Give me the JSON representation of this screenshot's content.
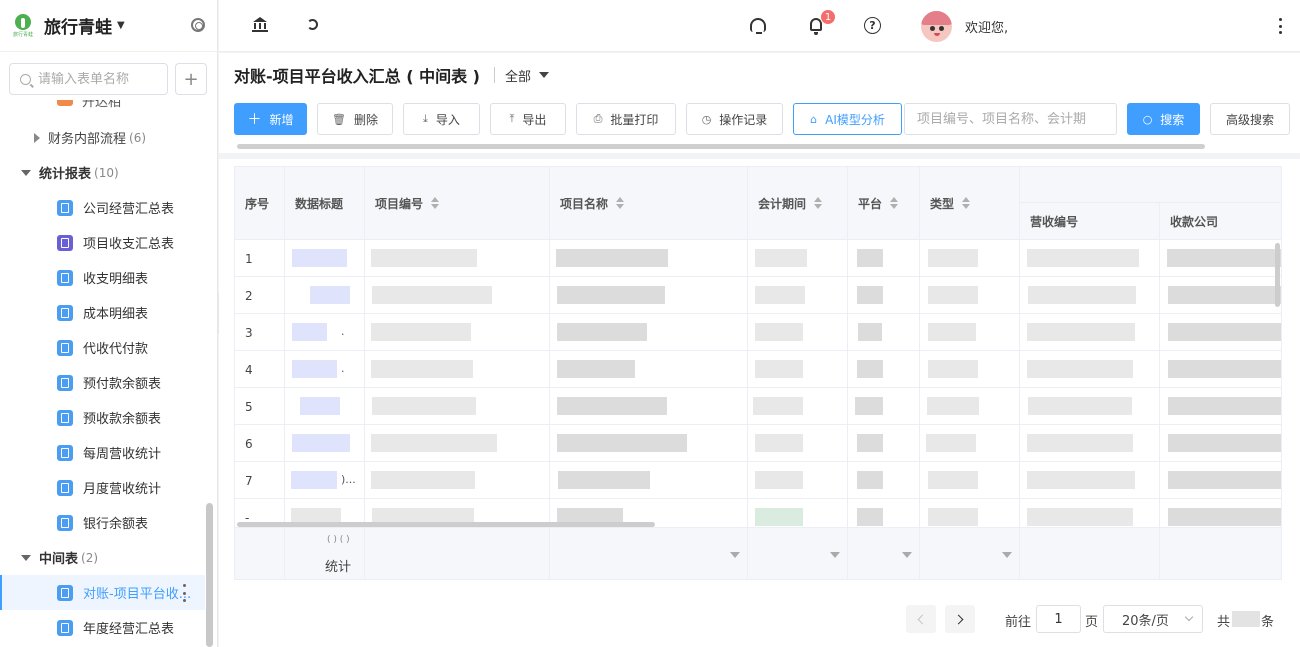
{
  "app": {
    "brand_name": "旅行青蛙",
    "logo_text": "旅行青蛙",
    "welcome_text": "欢迎您,",
    "notification_count": "1"
  },
  "sidebar": {
    "search_placeholder": "请输入表单名称",
    "add_label": "+",
    "cut_item_label": "开达相场",
    "groups": [
      {
        "label": "财务内部流程",
        "count": "(6)",
        "expanded": false
      },
      {
        "label": "统计报表",
        "count": "(10)",
        "expanded": true
      },
      {
        "label": "中间表",
        "count": "(2)",
        "expanded": true
      }
    ],
    "report_items": [
      {
        "label": "公司经营汇总表",
        "icon": "form-icon"
      },
      {
        "label": "项目收支汇总表",
        "icon": "form-icon-purple"
      },
      {
        "label": "收支明细表",
        "icon": "form-icon"
      },
      {
        "label": "成本明细表",
        "icon": "form-icon"
      },
      {
        "label": "代收代付款",
        "icon": "form-icon"
      },
      {
        "label": "预付款余额表",
        "icon": "form-icon"
      },
      {
        "label": "预收款余额表",
        "icon": "form-icon"
      },
      {
        "label": "每周营收统计",
        "icon": "form-icon"
      },
      {
        "label": "月度营收统计",
        "icon": "form-icon"
      },
      {
        "label": "银行余额表",
        "icon": "form-icon"
      }
    ],
    "middle_items": [
      {
        "label": "对账-项目平台收...",
        "active": true
      },
      {
        "label": "年度经营汇总表",
        "active": false
      }
    ]
  },
  "page": {
    "title": "对账-项目平台收入汇总 ( 中间表 )",
    "scope_label": "全部"
  },
  "toolbar": {
    "add_label": "新增",
    "delete_label": "删除",
    "import_label": "导入",
    "export_label": "导出",
    "batch_print_label": "批量打印",
    "history_label": "操作记录",
    "ai_label": "AI模型分析",
    "search_placeholder": "项目编号、项目名称、会计期",
    "search_label": "搜索",
    "advanced_label": "高级搜索"
  },
  "table": {
    "columns": [
      "序号",
      "数据标题",
      "项目编号",
      "项目名称",
      "会计期间",
      "平台",
      "类型"
    ],
    "sub_columns": [
      "营收编号",
      "收款公司"
    ],
    "row_numbers": [
      "1",
      "2",
      "3",
      "4",
      "5",
      "6",
      "7",
      "-"
    ],
    "row_tails": [
      "",
      "",
      ".",
      ".",
      "",
      "",
      ")...",
      ""
    ],
    "footer_label": "统计",
    "footer_dots": "( ) ( )"
  },
  "pagination": {
    "goto_label": "前往",
    "current_page": "1",
    "page_unit": "页",
    "page_size": "20条/页",
    "total_prefix": "共",
    "total_suffix": "条"
  },
  "colors": {
    "primary": "#409eff",
    "badge": "#f56c6c",
    "brand_green": "#4caf50"
  }
}
